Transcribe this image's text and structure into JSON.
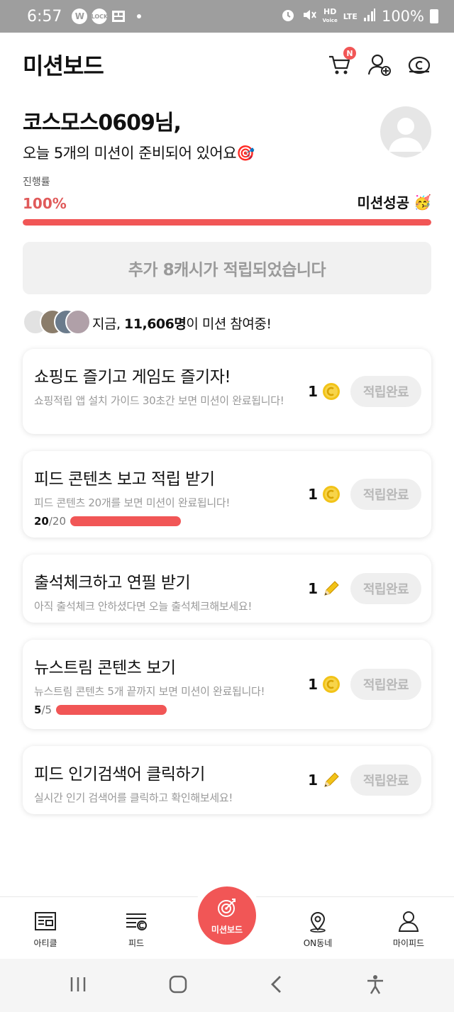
{
  "status_bar": {
    "time": "6:57",
    "battery": "100%",
    "network": "LTE",
    "hd_label": "HD",
    "voice_label": "Voice"
  },
  "header": {
    "title": "미션보드",
    "cart_badge": "N"
  },
  "greeting": {
    "name": "코스모스0609님,",
    "subtitle": "오늘 5개의 미션이 준비되어 있어요🎯"
  },
  "progress": {
    "label": "진행률",
    "percent_text": "100%",
    "percent_value": 100,
    "status": "미션성공",
    "status_emoji": "🥳"
  },
  "cash_banner": "추가 8캐시가 적립되었습니다",
  "participants": {
    "prefix": "지금, ",
    "count": "11,606명",
    "suffix": "이 미션 참여중!"
  },
  "missions": [
    {
      "title": "쇼핑도 즐기고 게임도 즐기자!",
      "desc": "쇼핑적립 앱 설치 가이드 30초간 보면 미션이 완료됩니다!",
      "reward": "1",
      "reward_icon": "coin-icon",
      "button": "적립완료",
      "progress": null
    },
    {
      "title": "피드 콘텐츠 보고 적립 받기",
      "desc": "피드 콘텐츠 20개를 보면 미션이 완료됩니다!",
      "reward": "1",
      "reward_icon": "coin-icon",
      "button": "적립완료",
      "progress": {
        "current": "20",
        "total": "/20"
      }
    },
    {
      "title": "출석체크하고 연필 받기",
      "desc": "아직 출석체크 안하셨다면 오늘 출석체크해보세요!",
      "reward": "1",
      "reward_icon": "pencil-icon",
      "button": "적립완료",
      "progress": null
    },
    {
      "title": "뉴스트림 콘텐츠 보기",
      "desc": "뉴스트림 콘텐츠 5개 끝까지 보면 미션이 완료됩니다!",
      "reward": "1",
      "reward_icon": "coin-icon",
      "button": "적립완료",
      "progress": {
        "current": "5",
        "total": "/5"
      }
    },
    {
      "title": "피드 인기검색어 클릭하기",
      "desc": "실시간 인기 검색어를 클릭하고 확인해보세요!",
      "reward": "1",
      "reward_icon": "pencil-icon",
      "button": "적립완료",
      "progress": null
    }
  ],
  "bottom_nav": {
    "items": [
      {
        "label": "아티클",
        "icon": "article-icon"
      },
      {
        "label": "피드",
        "icon": "feed-icon"
      },
      {
        "label": "미션보드",
        "icon": "target-icon"
      },
      {
        "label": "ON동네",
        "icon": "location-icon"
      },
      {
        "label": "마이피드",
        "icon": "person-icon"
      }
    ]
  },
  "colors": {
    "accent": "#f15656",
    "progress_text": "#e05a5a",
    "disabled_button": "#efefef",
    "coin": "#f2c318"
  }
}
